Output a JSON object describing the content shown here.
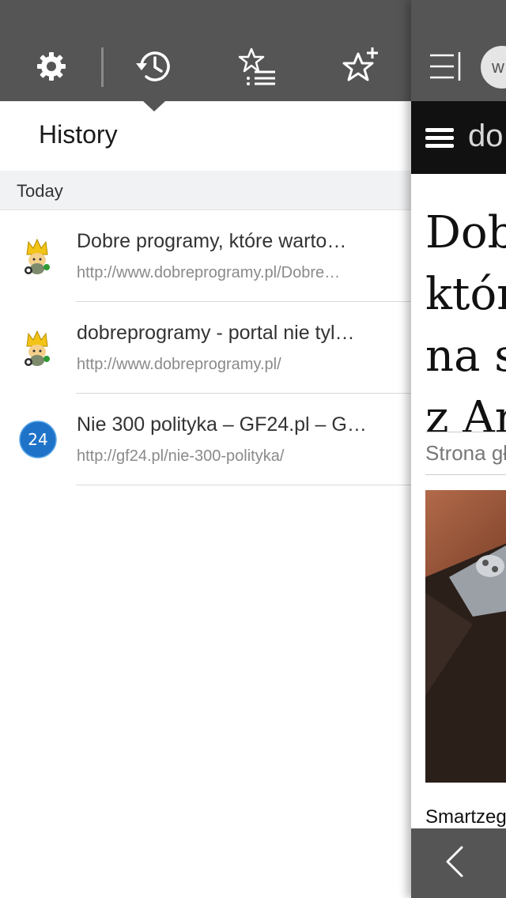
{
  "toolbar": {
    "icons": [
      "gear-icon",
      "history-icon",
      "reading-list-icon",
      "add-favorite-icon"
    ],
    "active": "history-icon"
  },
  "panel": {
    "title": "History",
    "section": "Today"
  },
  "history": [
    {
      "icon": "dobreprogramy-favicon",
      "title": "Dobre programy, które warto…",
      "url": "http://www.dobreprogramy.pl/Dobre…"
    },
    {
      "icon": "dobreprogramy-favicon",
      "title": "dobreprogramy - portal nie tyl…",
      "url": "http://www.dobreprogramy.pl/"
    },
    {
      "icon": "gf24-favicon",
      "title": "Nie 300 polityka – GF24.pl – G…",
      "url": "http://gf24.pl/nie-300-polityka/"
    }
  ],
  "background_page": {
    "avatar_letter": "w",
    "site_logo": "do",
    "article_title": "Dob\nktór\nna s\nz Ar",
    "breadcrumb": "Strona gł",
    "caption": "Smartzeg"
  },
  "colors": {
    "toolbar": "#555555",
    "section_bg": "#f1f2f4",
    "gf24_blue": "#1e73c8"
  }
}
